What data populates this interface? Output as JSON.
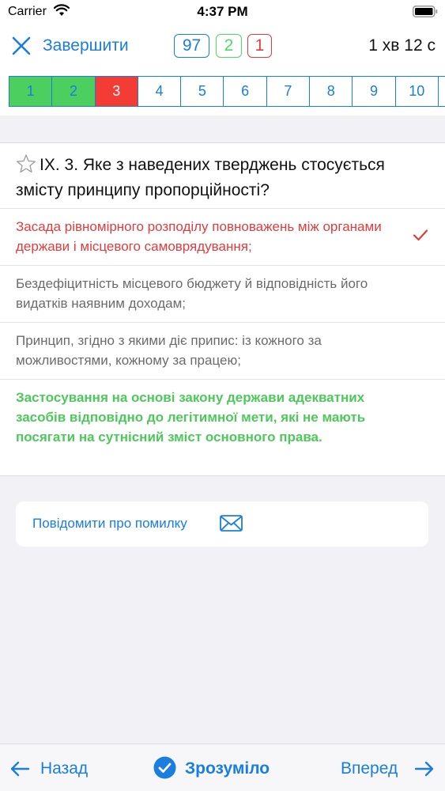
{
  "status_bar": {
    "carrier": "Carrier",
    "time": "4:37 PM"
  },
  "nav": {
    "finish_label": "Завершити",
    "count_total": "97",
    "count_correct": "2",
    "count_wrong": "1",
    "timer": "1 хв 12 с"
  },
  "question_strip": [
    {
      "label": "1",
      "state": "correct"
    },
    {
      "label": "2",
      "state": "correct"
    },
    {
      "label": "3",
      "state": "wrong"
    },
    {
      "label": "4",
      "state": "unanswered"
    },
    {
      "label": "5",
      "state": "unanswered"
    },
    {
      "label": "6",
      "state": "unanswered"
    },
    {
      "label": "7",
      "state": "unanswered"
    },
    {
      "label": "8",
      "state": "unanswered"
    },
    {
      "label": "9",
      "state": "unanswered"
    },
    {
      "label": "10",
      "state": "unanswered"
    },
    {
      "label": "",
      "state": "unanswered"
    }
  ],
  "question": {
    "text": "IX. 3. Яке з наведених тверджень стосується змісту принципу пропорційності?",
    "star_icon": "star-outline-icon"
  },
  "answers": [
    {
      "text": "Засада рівномірного розподілу повноважень між органами держави і місцевого самоврядування;",
      "state": "selected-wrong"
    },
    {
      "text": "Бездефіцитність місцевого бюджету й відповідність його видатків наявним доходам;",
      "state": "neutral"
    },
    {
      "text": "Принцип, згідно з якими діє припис: із кожного за можливостями, кожному за працею;",
      "state": "neutral"
    },
    {
      "text": "Застосування на основі закону держави адекватних засобів відповідно до легітимної мети, які не мають посягати на сутнісний зміст основного права.",
      "state": "correct"
    }
  ],
  "report": {
    "label": "Повідомити про помилку",
    "icon": "mail-icon"
  },
  "bottom_bar": {
    "back_label": "Назад",
    "ok_label": "Зрозуміло",
    "next_label": "Вперед"
  },
  "colors": {
    "accent": "#1a7de0",
    "correct": "#4cd964",
    "wrong": "#e03c3c"
  }
}
